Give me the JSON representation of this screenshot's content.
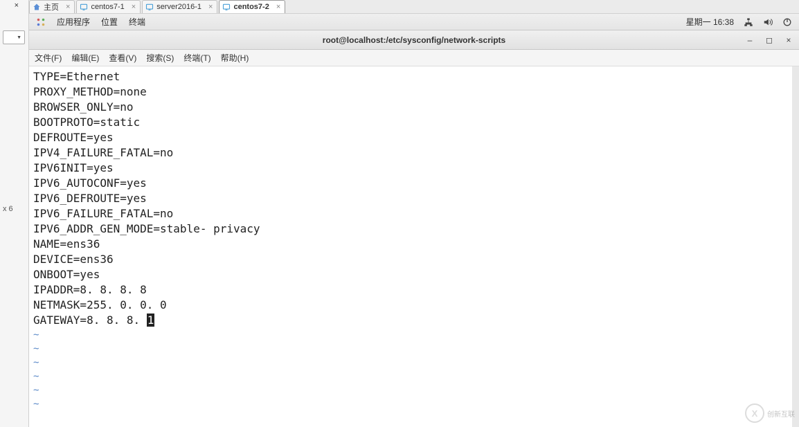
{
  "left_panel": {
    "label": "x 6"
  },
  "tabs": [
    {
      "label": "主页",
      "icon": "home"
    },
    {
      "label": "centos7-1",
      "icon": "vm"
    },
    {
      "label": "server2016-1",
      "icon": "vm"
    },
    {
      "label": "centos7-2",
      "icon": "vm",
      "active": true
    }
  ],
  "gnome": {
    "apps": "应用程序",
    "places": "位置",
    "terminal": "终端",
    "datetime": "星期一 16:38"
  },
  "window": {
    "title": "root@localhost:/etc/sysconfig/network-scripts"
  },
  "terminal_menu": {
    "file": "文件(F)",
    "edit": "编辑(E)",
    "view": "查看(V)",
    "search": "搜索(S)",
    "terminal": "终端(T)",
    "help": "帮助(H)"
  },
  "terminal_lines": [
    "TYPE=Ethernet",
    "PROXY_METHOD=none",
    "BROWSER_ONLY=no",
    "BOOTPROTO=static",
    "DEFROUTE=yes",
    "IPV4_FAILURE_FATAL=no",
    "IPV6INIT=yes",
    "IPV6_AUTOCONF=yes",
    "IPV6_DEFROUTE=yes",
    "IPV6_FAILURE_FATAL=no",
    "IPV6_ADDR_GEN_MODE=stable- privacy",
    "NAME=ens36",
    "DEVICE=ens36",
    "ONBOOT=yes",
    "IPADDR=8. 8. 8. 8",
    "NETMASK=255. 0. 0. 0"
  ],
  "terminal_last_line": {
    "before_cursor": "GATEWAY=8. 8. 8. ",
    "cursor_char": "1"
  },
  "tilde_count": 6,
  "watermark": {
    "text": "创新互联",
    "logo": "X"
  }
}
